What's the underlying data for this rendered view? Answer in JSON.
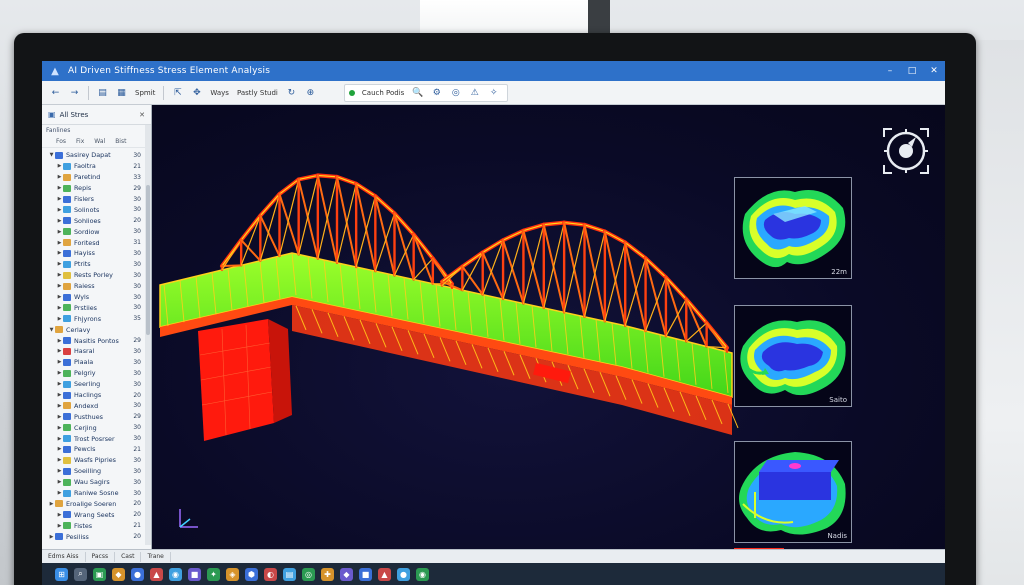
{
  "window": {
    "title": "AI Driven Stiffness Stress Element Analysis",
    "controls": [
      "–",
      "□",
      "✕"
    ]
  },
  "toolbar": {
    "buttons": [
      {
        "name": "back-icon",
        "glyph": "←"
      },
      {
        "name": "forward-icon",
        "glyph": "→"
      },
      {
        "name": "layers-icon",
        "glyph": "▤"
      },
      {
        "name": "grid-icon",
        "glyph": "▦"
      },
      {
        "name": "select-icon",
        "glyph": "⇱"
      },
      {
        "name": "move-icon",
        "glyph": "✥"
      },
      {
        "name": "rotate-icon",
        "glyph": "↻"
      },
      {
        "name": "zoom-icon",
        "glyph": "⊕"
      }
    ],
    "label_1": "Spmit",
    "label_2": "Ways",
    "label_3": "Pastly Studi",
    "group_label": "Cauch Podis",
    "group_icons": [
      "🔍",
      "⚙",
      "◎",
      "⚠",
      "✧"
    ]
  },
  "sidebar": {
    "header": "All Stres",
    "subheader": "Fanlines",
    "columns": [
      "Fos",
      "Fix",
      "Wal",
      "Bist"
    ],
    "items": [
      {
        "label": "Sasirey Dapat",
        "value": "30",
        "color": "#3b6fd8",
        "level": 0,
        "expanded": true
      },
      {
        "label": "Faoltra",
        "value": "21",
        "color": "#3fa0e0",
        "level": 1
      },
      {
        "label": "Paretind",
        "value": "33",
        "color": "#e0a43f",
        "level": 1
      },
      {
        "label": "Repis",
        "value": "29",
        "color": "#4db35a",
        "level": 1
      },
      {
        "label": "Fislers",
        "value": "30",
        "color": "#3b6fd8",
        "level": 1
      },
      {
        "label": "Solinots",
        "value": "30",
        "color": "#3fa0e0",
        "level": 1
      },
      {
        "label": "Sohlioes",
        "value": "20",
        "color": "#3b6fd8",
        "level": 1
      },
      {
        "label": "Sordiow",
        "value": "30",
        "color": "#4db35a",
        "level": 1
      },
      {
        "label": "Foritesd",
        "value": "31",
        "color": "#e0a43f",
        "level": 1
      },
      {
        "label": "Hayiss",
        "value": "30",
        "color": "#3b6fd8",
        "level": 1
      },
      {
        "label": "Ptrits",
        "value": "30",
        "color": "#3fa0e0",
        "level": 1
      },
      {
        "label": "Rests Porley",
        "value": "30",
        "color": "#e0c03f",
        "level": 1
      },
      {
        "label": "Raiess",
        "value": "30",
        "color": "#e0a43f",
        "level": 1
      },
      {
        "label": "Wyls",
        "value": "30",
        "color": "#3b6fd8",
        "level": 1
      },
      {
        "label": "Prstiies",
        "value": "30",
        "color": "#4db35a",
        "level": 1
      },
      {
        "label": "Fhjyrons",
        "value": "35",
        "color": "#3fa0e0",
        "level": 1
      },
      {
        "label": "Cerlavy",
        "value": "",
        "color": "#e0a43f",
        "level": 0,
        "expanded": true
      },
      {
        "label": "Nasitis Pontos",
        "value": "29",
        "color": "#3b6fd8",
        "level": 1
      },
      {
        "label": "Hasral",
        "value": "30",
        "color": "#d94040",
        "level": 1
      },
      {
        "label": "Plaala",
        "value": "30",
        "color": "#3b6fd8",
        "level": 1
      },
      {
        "label": "Pelgriy",
        "value": "30",
        "color": "#4db35a",
        "level": 1
      },
      {
        "label": "Seerling",
        "value": "30",
        "color": "#3fa0e0",
        "level": 1
      },
      {
        "label": "Haclings",
        "value": "20",
        "color": "#3b6fd8",
        "level": 1
      },
      {
        "label": "Andexd",
        "value": "30",
        "color": "#e0a43f",
        "level": 1
      },
      {
        "label": "Pusthues",
        "value": "29",
        "color": "#3b6fd8",
        "level": 1
      },
      {
        "label": "Cerjing",
        "value": "30",
        "color": "#4db35a",
        "level": 1
      },
      {
        "label": "Trost Posrser",
        "value": "30",
        "color": "#3fa0e0",
        "level": 1
      },
      {
        "label": "Pewcls",
        "value": "21",
        "color": "#3b6fd8",
        "level": 1
      },
      {
        "label": "Wasfs Pipries",
        "value": "30",
        "color": "#e0c03f",
        "level": 1
      },
      {
        "label": "Soeilling",
        "value": "30",
        "color": "#3b6fd8",
        "level": 1
      },
      {
        "label": "Wau Sagirs",
        "value": "30",
        "color": "#4db35a",
        "level": 1
      },
      {
        "label": "Raniwe Sosne",
        "value": "30",
        "color": "#3fa0e0",
        "level": 1
      },
      {
        "label": "Eroalige Soeren",
        "value": "20",
        "color": "#e0a43f",
        "level": 0
      },
      {
        "label": "Wrang Seets",
        "value": "20",
        "color": "#3b6fd8",
        "level": 1
      },
      {
        "label": "Fistes",
        "value": "21",
        "color": "#4db35a",
        "level": 1
      },
      {
        "label": "Pesiliss",
        "value": "20",
        "color": "#3b6fd8",
        "level": 0
      }
    ]
  },
  "viewport": {
    "thumbnails": [
      {
        "label": "22m"
      },
      {
        "label": "Saito"
      },
      {
        "label": "Nadis"
      }
    ]
  },
  "statusbar": {
    "items": [
      "Edms Aiss",
      "Pacss",
      "Cast",
      "Trane"
    ]
  },
  "taskbar": {
    "apps": [
      {
        "name": "start-icon",
        "glyph": "⊞",
        "color": "#3a8ee6"
      },
      {
        "name": "search-icon",
        "glyph": "⌕",
        "color": "#55657a"
      },
      {
        "name": "app-icon-1",
        "glyph": "▣",
        "color": "#2b9a52"
      },
      {
        "name": "app-icon-2",
        "glyph": "◆",
        "color": "#d6932b"
      },
      {
        "name": "app-icon-3",
        "glyph": "●",
        "color": "#3b6fd8"
      },
      {
        "name": "app-icon-4",
        "glyph": "▲",
        "color": "#c94848"
      },
      {
        "name": "app-icon-5",
        "glyph": "◉",
        "color": "#3fa0e0"
      },
      {
        "name": "app-icon-6",
        "glyph": "■",
        "color": "#6a5acd"
      },
      {
        "name": "app-icon-7",
        "glyph": "✦",
        "color": "#2b9a52"
      },
      {
        "name": "app-icon-8",
        "glyph": "◈",
        "color": "#d6932b"
      },
      {
        "name": "app-icon-9",
        "glyph": "⬢",
        "color": "#3b6fd8"
      },
      {
        "name": "app-icon-10",
        "glyph": "◐",
        "color": "#c94848"
      },
      {
        "name": "app-icon-11",
        "glyph": "▤",
        "color": "#3fa0e0"
      },
      {
        "name": "app-icon-12",
        "glyph": "◎",
        "color": "#2b9a52"
      },
      {
        "name": "app-icon-13",
        "glyph": "✚",
        "color": "#d6932b"
      },
      {
        "name": "app-icon-14",
        "glyph": "◆",
        "color": "#6a5acd"
      },
      {
        "name": "app-icon-15",
        "glyph": "■",
        "color": "#3b6fd8"
      },
      {
        "name": "app-icon-16",
        "glyph": "▲",
        "color": "#c94848"
      },
      {
        "name": "app-icon-17",
        "glyph": "●",
        "color": "#3fa0e0"
      },
      {
        "name": "app-icon-18",
        "glyph": "◉",
        "color": "#2b9a52"
      }
    ]
  }
}
